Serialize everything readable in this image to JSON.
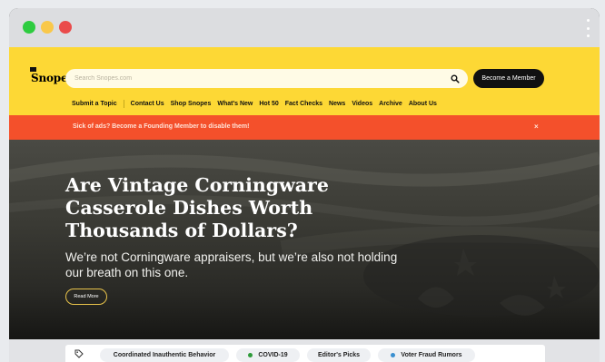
{
  "chrome": {
    "dots": [
      {
        "color": "#2ecc40"
      },
      {
        "color": "#f9c84a"
      },
      {
        "color": "#ea4b4b"
      }
    ]
  },
  "header": {
    "logo_text": "Snopes",
    "search_placeholder": "Search Snopes.com",
    "member_button": "Become a Member",
    "nav_items": [
      "Submit a Topic",
      "Contact Us",
      "Shop Snopes",
      "What's New",
      "Hot 50",
      "Fact Checks",
      "News",
      "Videos",
      "Archive",
      "About Us"
    ]
  },
  "alert": {
    "text": "Sick of ads? Become a Founding Member to disable them!",
    "close": "×"
  },
  "hero": {
    "title": "Are Vintage Corningware Casserole Dishes Worth Thousands of Dollars?",
    "subtitle": "We’re not Corningware appraisers, but we’re also not holding our breath on this one.",
    "cta": "Read More"
  },
  "topics": {
    "pills": [
      {
        "label": "Coordinated Inauthentic Behavior",
        "bullet": ""
      },
      {
        "label": "COVID-19",
        "bullet": "#2e9b3a"
      },
      {
        "label": "Editor's Picks",
        "bullet": ""
      },
      {
        "label": "Voter Fraud Rumors",
        "bullet": "#3a8fd0"
      }
    ]
  },
  "colors": {
    "brand_yellow": "#fdd835",
    "alert_red": "#f4502b",
    "hero_dark": "#2d2d29"
  }
}
